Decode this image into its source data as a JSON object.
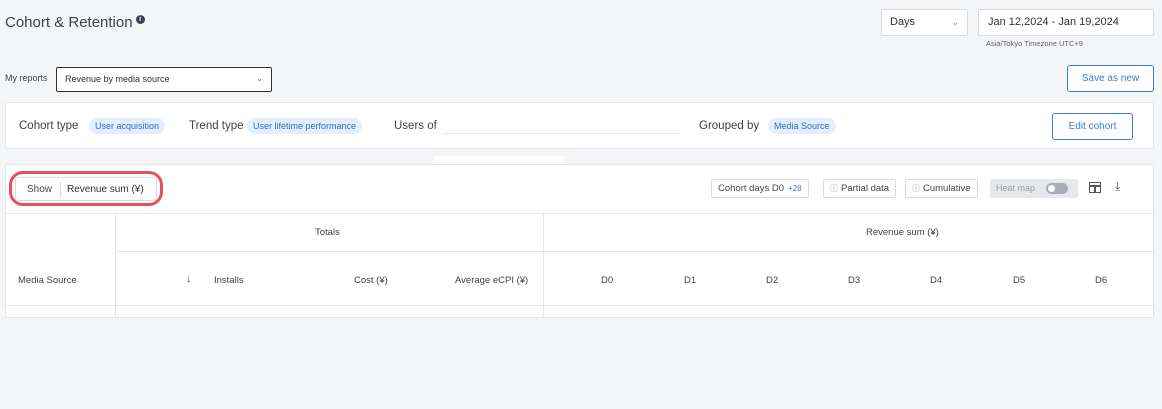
{
  "header": {
    "title": "Cohort & Retention",
    "info_icon": "info-icon",
    "period_select": "Days",
    "date_range": "Jan 12,2024 - Jan 19,2024",
    "timezone": "Asia/Tokyo Timezone UTC+9"
  },
  "reports": {
    "label": "My reports",
    "selected": "Revenue by media source",
    "save_label": "Save as new"
  },
  "cohort": {
    "type_label": "Cohort type",
    "type_value": "User acquisition",
    "trend_label": "Trend type",
    "trend_value": "User lifetime performance",
    "users_label": "Users of",
    "grouped_label": "Grouped by",
    "grouped_value": "Media Source",
    "edit_label": "Edit cohort"
  },
  "toolbar": {
    "show_label": "Show",
    "show_value": "Revenue sum (¥)",
    "cohort_days_label": "Cohort days D0",
    "cohort_days_plus": "+28",
    "partial_label": "Partial data",
    "cumulative_label": "Cumulative",
    "heatmap_label": "Heat map"
  },
  "table": {
    "totals_header": "Totals",
    "revenue_header": "Revenue sum (¥)",
    "col_media_source": "Media Source",
    "sort_arrow": "↓",
    "col_installs": "Installs",
    "col_cost": "Cost (¥)",
    "col_ecpi": "Average eCPI (¥)",
    "days": [
      "D0",
      "D1",
      "D2",
      "D3",
      "D4",
      "D5",
      "D6"
    ]
  },
  "colors": {
    "accent": "#3b7dd8",
    "highlight": "#e8505b",
    "chip_bg": "#e3effc"
  }
}
